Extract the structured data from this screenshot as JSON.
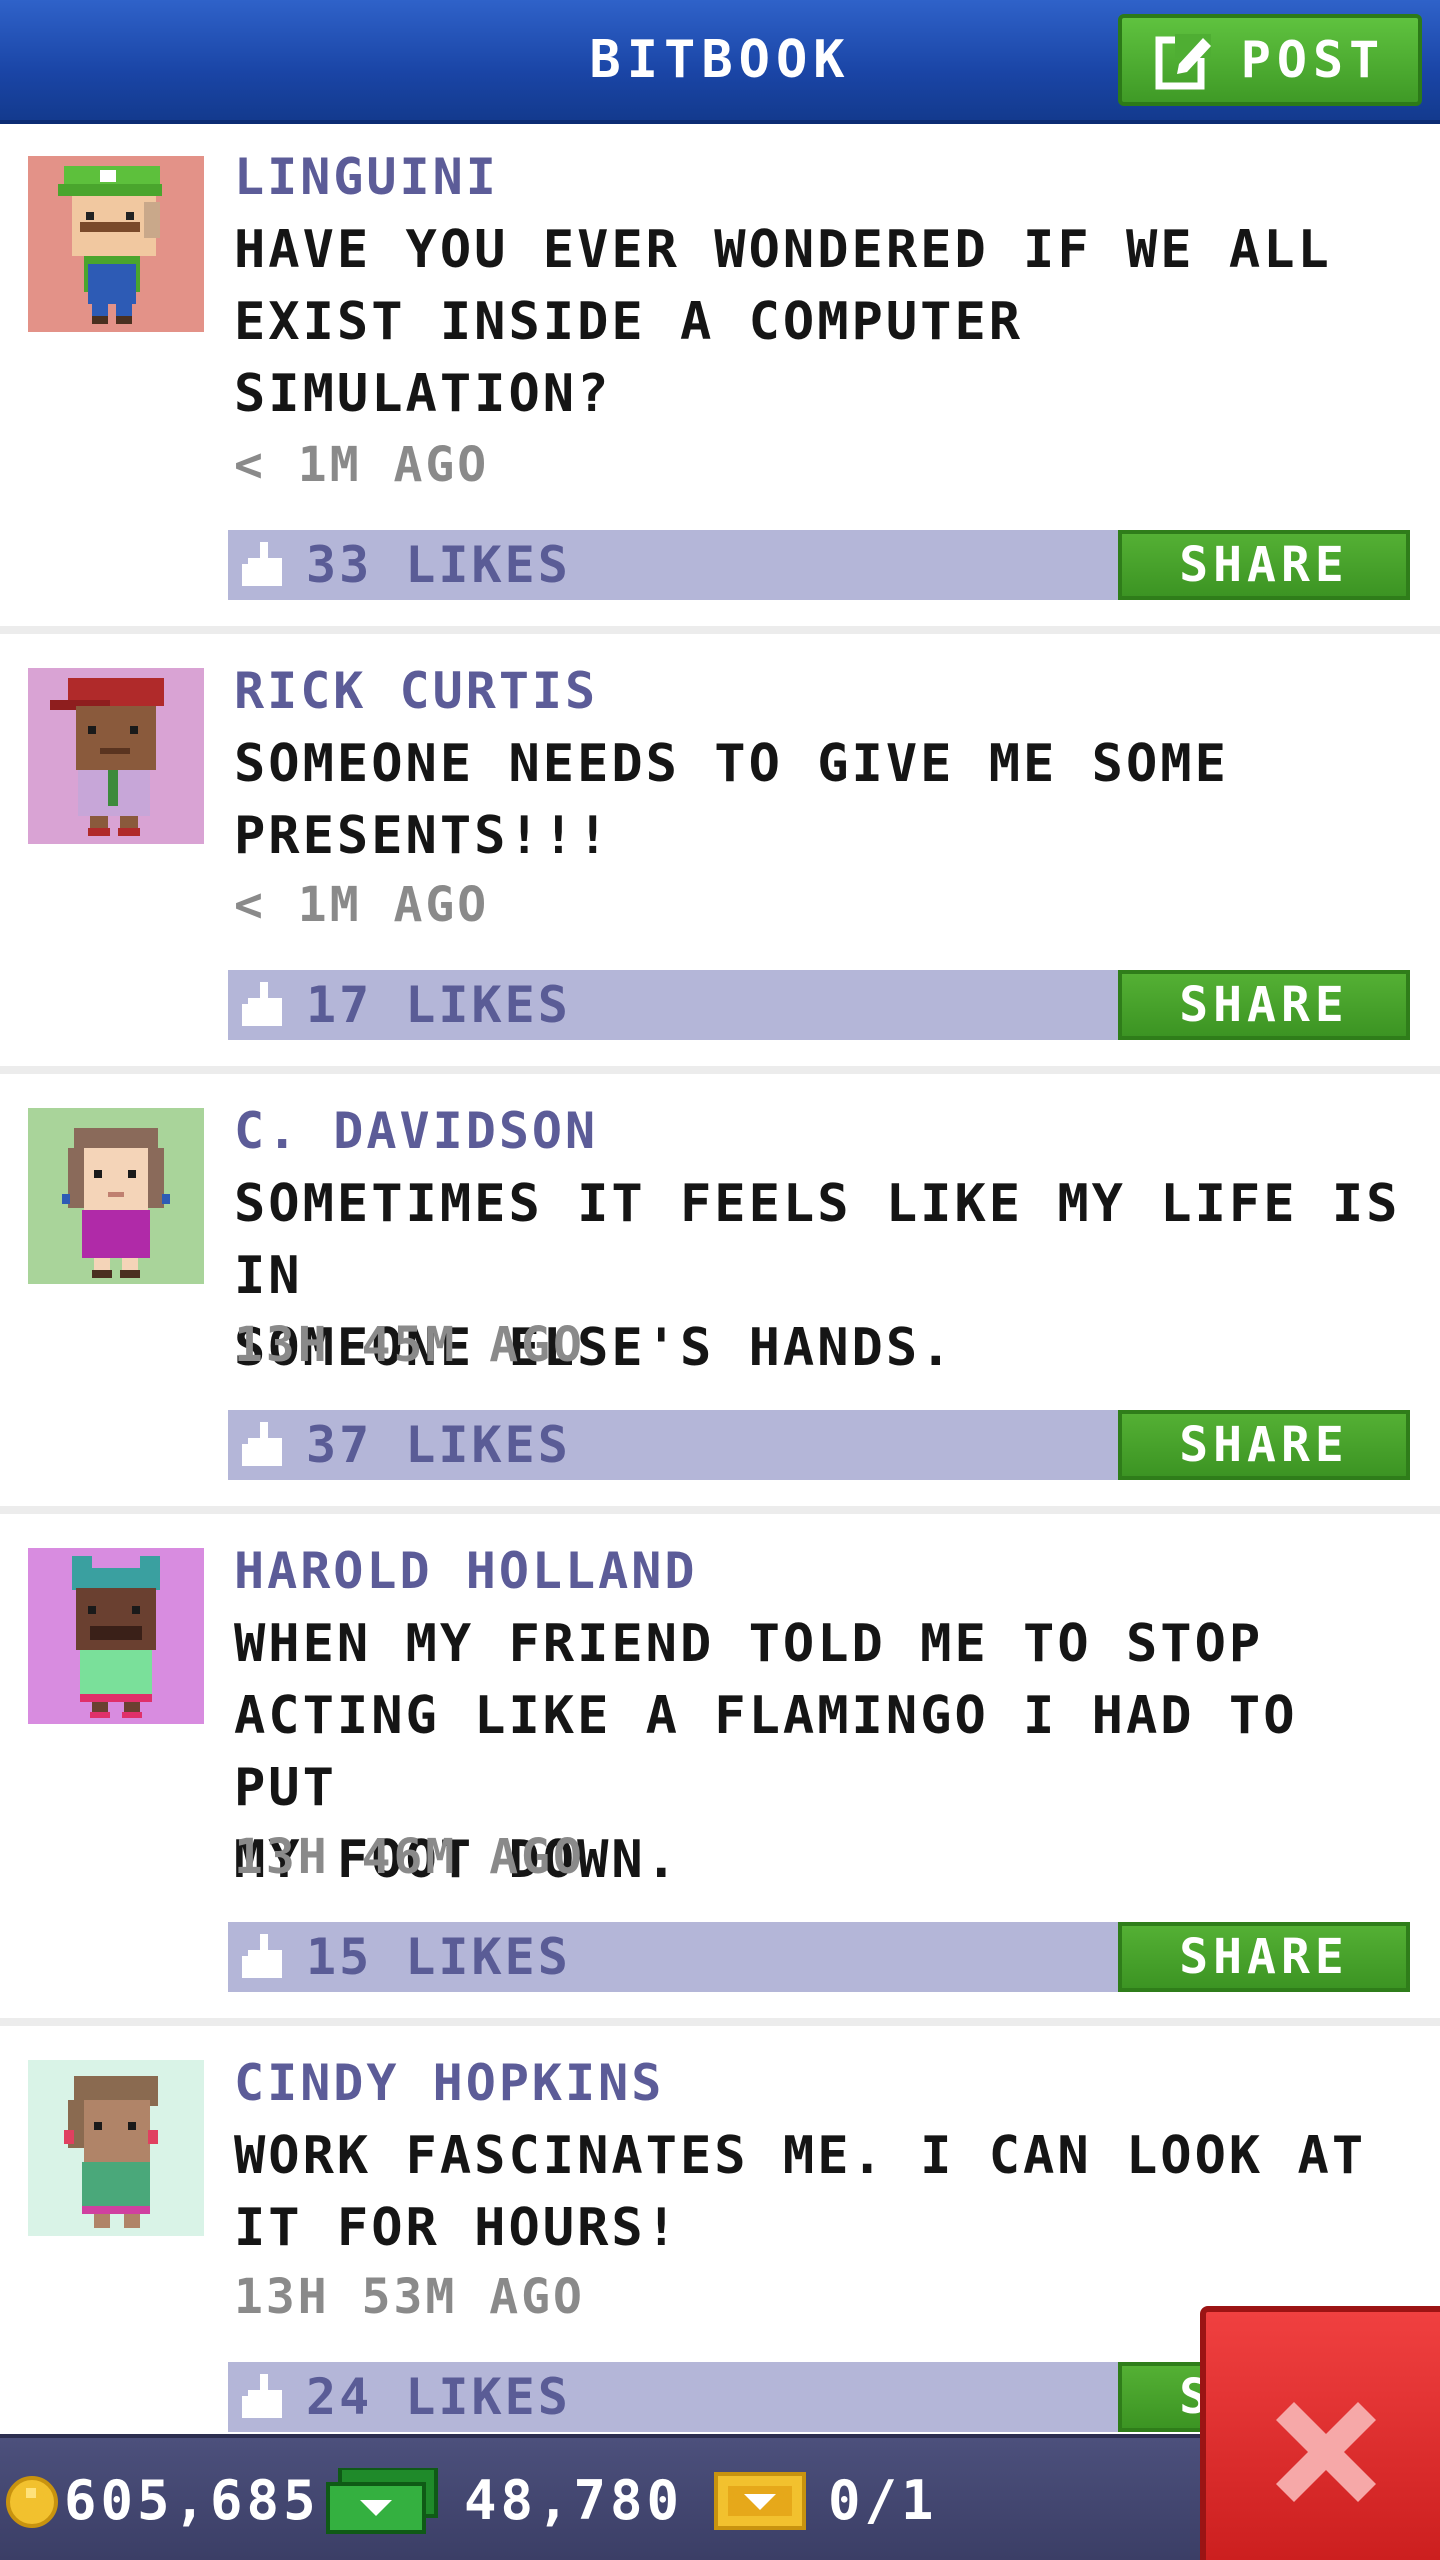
{
  "header": {
    "title": "BITBOOK",
    "post_label": "POST"
  },
  "posts": [
    {
      "author": "LINGUINI",
      "lines": [
        "HAVE YOU EVER WONDERED IF WE ALL",
        "EXIST INSIDE A COMPUTER",
        "SIMULATION?"
      ],
      "time": "< 1M AGO",
      "likes": "33 LIKES",
      "share": "SHARE",
      "avatar_bg": "#e39288",
      "avatar_icon": "plumber-green-cap-avatar-icon"
    },
    {
      "author": "RICK CURTIS",
      "lines": [
        "SOMEONE NEEDS TO GIVE ME SOME",
        "PRESENTS!!!"
      ],
      "time": "< 1M AGO",
      "likes": "17 LIKES",
      "share": "SHARE",
      "avatar_bg": "#d9a3d4",
      "avatar_icon": "red-cap-man-avatar-icon"
    },
    {
      "author": "C. DAVIDSON",
      "lines": [
        "SOMETIMES IT FEELS LIKE MY LIFE IS IN",
        "SOMEONE ELSE'S HANDS."
      ],
      "time": "13H 45M AGO",
      "likes": "37 LIKES",
      "share": "SHARE",
      "avatar_bg": "#a9d49a",
      "avatar_icon": "woman-magenta-shirt-avatar-icon"
    },
    {
      "author": "HAROLD HOLLAND",
      "lines": [
        "WHEN MY FRIEND TOLD ME TO STOP",
        "ACTING LIKE A FLAMINGO I HAD TO PUT",
        "MY FOOT DOWN."
      ],
      "time": "13H 46M AGO",
      "likes": "15 LIKES",
      "share": "SHARE",
      "avatar_bg": "#d88ce0",
      "avatar_icon": "frog-hat-man-avatar-icon"
    },
    {
      "author": "CINDY HOPKINS",
      "lines": [
        "WORK FASCINATES ME. I CAN LOOK AT",
        "IT FOR HOURS!"
      ],
      "time": "13H 53M AGO",
      "likes": "24 LIKES",
      "share": "SHARE",
      "avatar_bg": "#d9f3e7",
      "avatar_icon": "woman-green-shirt-avatar-icon"
    }
  ],
  "status": {
    "coins": "605,685",
    "bux": "48,780",
    "tickets": "0/1"
  },
  "colors": {
    "header_blue": "#1a45a6",
    "share_green": "#4aa52d",
    "likes_bar": "#b4b6d8",
    "author_purple": "#5c5c98",
    "close_red": "#e02f2f"
  }
}
